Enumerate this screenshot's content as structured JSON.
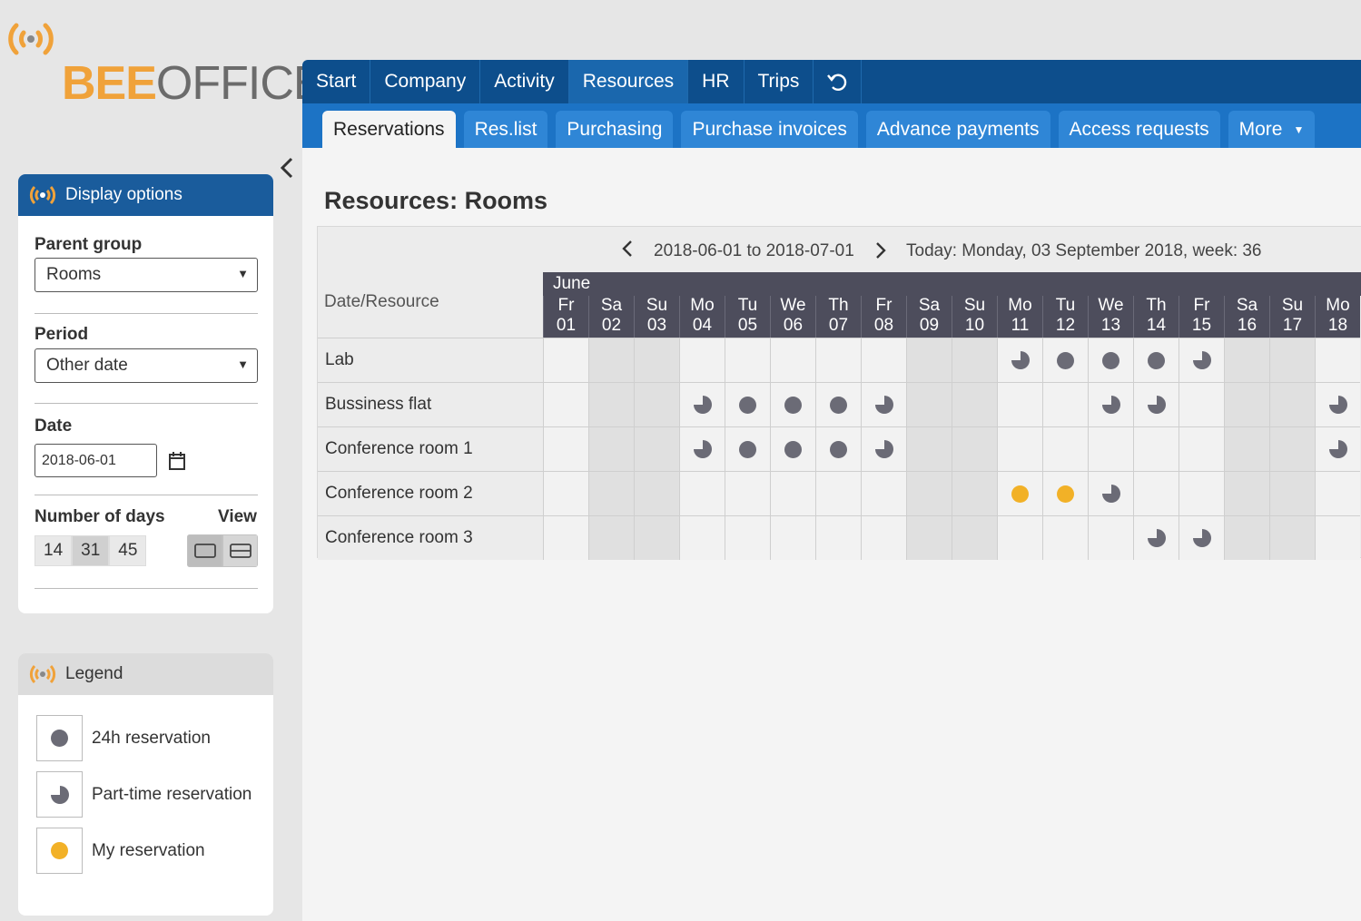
{
  "brand": {
    "bee": "BEE",
    "office": "OFFICE"
  },
  "topnav": [
    {
      "label": "Start",
      "active": false
    },
    {
      "label": "Company",
      "active": false
    },
    {
      "label": "Activity",
      "active": false
    },
    {
      "label": "Resources",
      "active": true
    },
    {
      "label": "HR",
      "active": false
    },
    {
      "label": "Trips",
      "active": false
    }
  ],
  "subnav": [
    {
      "label": "Reservations",
      "active": true
    },
    {
      "label": "Res.list",
      "active": false
    },
    {
      "label": "Purchasing",
      "active": false
    },
    {
      "label": "Purchase invoices",
      "active": false
    },
    {
      "label": "Advance payments",
      "active": false
    },
    {
      "label": "Access requests",
      "active": false
    },
    {
      "label": "More",
      "active": false
    }
  ],
  "display_options": {
    "title": "Display options",
    "parent_group_label": "Parent group",
    "parent_group_value": "Rooms",
    "period_label": "Period",
    "period_value": "Other date",
    "date_label": "Date",
    "date_value": "2018-06-01",
    "days_label": "Number of days",
    "view_label": "View",
    "days_options": [
      "14",
      "31",
      "45"
    ],
    "days_selected": "31"
  },
  "legend": {
    "title": "Legend",
    "items": [
      {
        "label": "24h reservation",
        "kind": "full"
      },
      {
        "label": "Part-time reservation",
        "kind": "part"
      },
      {
        "label": "My reservation",
        "kind": "mine"
      }
    ]
  },
  "page": {
    "title": "Resources: Rooms",
    "range": "2018-06-01 to 2018-07-01",
    "today": "Today: Monday, 03 September 2018, week: 36",
    "date_resource_label": "Date/Resource",
    "month": "June"
  },
  "days": [
    {
      "dow": "Fr",
      "d": "01",
      "weekend": false
    },
    {
      "dow": "Sa",
      "d": "02",
      "weekend": true
    },
    {
      "dow": "Su",
      "d": "03",
      "weekend": true
    },
    {
      "dow": "Mo",
      "d": "04",
      "weekend": false
    },
    {
      "dow": "Tu",
      "d": "05",
      "weekend": false
    },
    {
      "dow": "We",
      "d": "06",
      "weekend": false
    },
    {
      "dow": "Th",
      "d": "07",
      "weekend": false
    },
    {
      "dow": "Fr",
      "d": "08",
      "weekend": false
    },
    {
      "dow": "Sa",
      "d": "09",
      "weekend": true
    },
    {
      "dow": "Su",
      "d": "10",
      "weekend": true
    },
    {
      "dow": "Mo",
      "d": "11",
      "weekend": false
    },
    {
      "dow": "Tu",
      "d": "12",
      "weekend": false
    },
    {
      "dow": "We",
      "d": "13",
      "weekend": false
    },
    {
      "dow": "Th",
      "d": "14",
      "weekend": false
    },
    {
      "dow": "Fr",
      "d": "15",
      "weekend": false
    },
    {
      "dow": "Sa",
      "d": "16",
      "weekend": true
    },
    {
      "dow": "Su",
      "d": "17",
      "weekend": true
    },
    {
      "dow": "Mo",
      "d": "18",
      "weekend": false
    }
  ],
  "resources": [
    {
      "name": "Lab",
      "cells": [
        "",
        "",
        "",
        "",
        "",
        "",
        "",
        "",
        "",
        "",
        "P",
        "F",
        "F",
        "F",
        "P",
        "",
        "",
        ""
      ]
    },
    {
      "name": "Bussiness flat",
      "cells": [
        "",
        "",
        "",
        "P",
        "F",
        "F",
        "F",
        "P",
        "",
        "",
        "",
        "",
        "P",
        "P",
        "",
        "",
        "",
        "P"
      ]
    },
    {
      "name": "Conference room 1",
      "cells": [
        "",
        "",
        "",
        "P",
        "F",
        "F",
        "F",
        "P",
        "",
        "",
        "",
        "",
        "",
        "",
        "",
        "",
        "",
        "P"
      ]
    },
    {
      "name": "Conference room 2",
      "cells": [
        "",
        "",
        "",
        "",
        "",
        "",
        "",
        "",
        "",
        "",
        "M",
        "M",
        "P",
        "",
        "",
        "",
        "",
        ""
      ]
    },
    {
      "name": "Conference room 3",
      "cells": [
        "",
        "",
        "",
        "",
        "",
        "",
        "",
        "",
        "",
        "",
        "",
        "",
        "",
        "P",
        "P",
        "",
        "",
        ""
      ]
    }
  ],
  "colors": {
    "nav": "#0d4e8c",
    "subnav": "#1c73c5",
    "full": "#6b6b76",
    "mine": "#f2b127",
    "brand_orange": "#f0a23a"
  }
}
